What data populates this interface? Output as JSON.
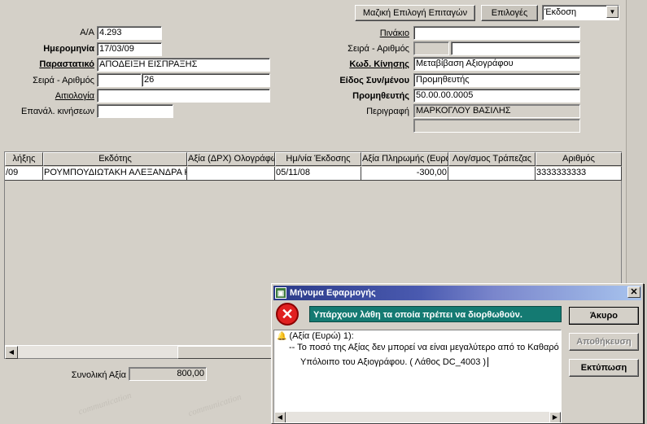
{
  "toolbar": {
    "bulk_select_label": "Μαζική Επιλογή Επιταγών",
    "options_label": "Επιλογές",
    "action_select_value": "Έκδοση"
  },
  "form_left": {
    "aa_label": "Α/Α",
    "aa_value": "4.293",
    "date_label": "Ημερομηνία",
    "date_value": "17/03/09",
    "doc_label": "Παραστατικό",
    "doc_value": "ΑΠΟΔΕΙΞΗ ΕΙΣΠΡΑΞΗΣ",
    "series_label": "Σειρά - Αριθμός",
    "series_value": "",
    "number_value": "26",
    "reason_label": "Αιτιολογία",
    "reason_value": "",
    "repeat_label": "Επανάλ. κινήσεων",
    "repeat_value": ""
  },
  "form_right": {
    "table_label": "Πινάκιο",
    "table_value": "",
    "series_label": "Σειρά - Αριθμός",
    "series_value": "",
    "number_value": "",
    "move_code_label": "Κωδ. Κίνησης",
    "move_code_value": "Μεταβίβαση Αξιογράφου",
    "partner_type_label": "Είδος Συν/μένου",
    "partner_type_value": "Προμηθευτής",
    "supplier_label": "Προμηθευτής",
    "supplier_value": "50.00.00.0005",
    "description_label": "Περιγραφή",
    "description_value": "ΜΑΡΚΟΓΛΟΥ ΒΑΣΙΛΗΣ",
    "extra_value": ""
  },
  "grid": {
    "headers": [
      "λήξης",
      "Εκδότης",
      "Αξία (ΔΡΧ) Ολογράφως",
      "Ημ/νία Έκδοσης",
      "Αξία Πληρωμής (Ευρώ)",
      "Λογ/σμος Τράπεζας",
      "Αριθμός"
    ],
    "row": [
      "/09",
      "ΡΟΥΜΠΟΥΔΙΩΤΑΚΗ ΑΛΕΞΑΝΔΡΑ ΚΑ",
      "",
      "05/11/08",
      "-300,00",
      "",
      "3333333333"
    ]
  },
  "total": {
    "label": "Συνολική Αξία",
    "value": "800,00"
  },
  "dialog": {
    "title": "Μήνυμα Εφαρμογής",
    "banner": "Υπάρχουν λάθη τα οποία πρέπει να διορθωθούν.",
    "error_header": "(Αξία (Ευρώ) 1):",
    "error_line1": "-- Το ποσό της Αξίας δεν μπορεί να είναι μεγαλύτερο από το Καθαρό",
    "error_line2": "Υπόλοιπο του Αξιογράφου. ( Λάθος DC_4003 )",
    "cancel_label": "Άκυρο",
    "save_label": "Αποθήκευση",
    "print_label": "Εκτύπωση"
  },
  "watermark": {
    "text": "communication"
  }
}
